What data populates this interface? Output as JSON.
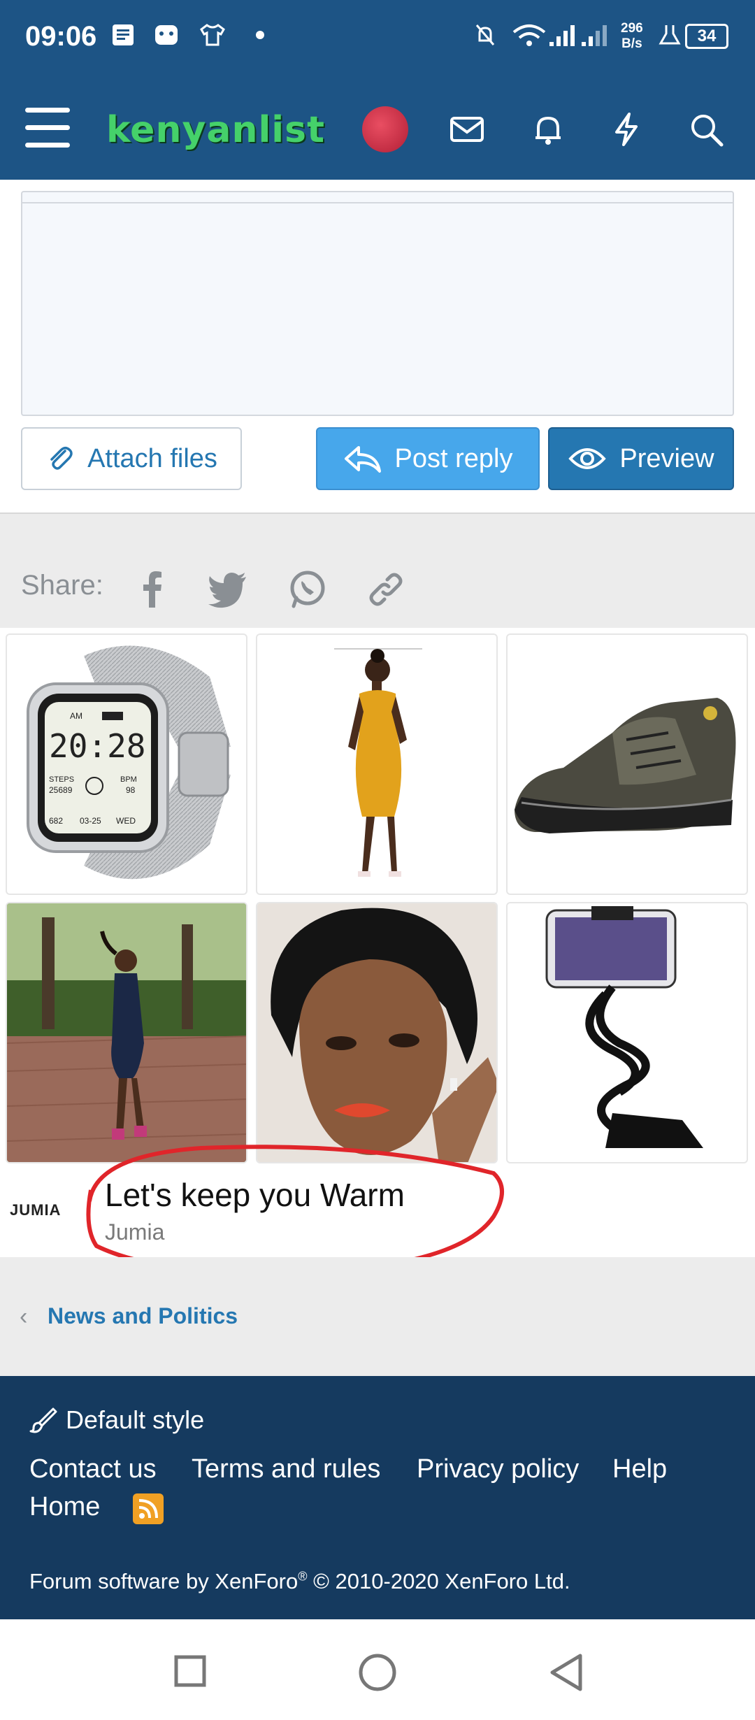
{
  "status_bar": {
    "time": "09:06",
    "network_speed_value": "296",
    "network_speed_unit": "B/s",
    "battery": "34",
    "icons": [
      "notes-icon",
      "game-icon",
      "shirt-icon",
      "dot-icon",
      "bell-off-icon",
      "wifi-icon",
      "signal-icon",
      "signal-icon-2",
      "lab-icon",
      "battery-icon"
    ]
  },
  "app_bar": {
    "logo": "kenyanlist",
    "icons": [
      "menu-icon",
      "avatar",
      "mail-icon",
      "bell-icon",
      "bolt-icon",
      "search-icon"
    ]
  },
  "editor": {
    "attach_label": "Attach files",
    "post_reply_label": "Post reply",
    "preview_label": "Preview"
  },
  "share": {
    "label": "Share:",
    "icons": [
      "facebook-icon",
      "twitter-icon",
      "whatsapp-icon",
      "link-icon"
    ]
  },
  "ad": {
    "brand": "JUMIA",
    "title": "Let's keep you Warm",
    "source": "Jumia",
    "watch_time": "20:28",
    "watch_steps": "25689",
    "watch_bpm": "98",
    "watch_date": "03-25",
    "watch_day": "WED",
    "watch_label_am": "AM",
    "watch_label_steps": "STEPS",
    "watch_label_bpm": "BPM",
    "watch_kcal": "682",
    "accent_color": "#1aa3b5",
    "annotation_color": "#e0252a"
  },
  "breadcrumb": {
    "link": "News and Politics"
  },
  "footer": {
    "style_label": "Default style",
    "links": [
      "Contact us",
      "Terms and rules",
      "Privacy policy",
      "Help",
      "Home"
    ],
    "copyright_prefix": "Forum software by XenForo",
    "copyright_mark": "®",
    "copyright_suffix": " © 2010-2020 XenForo Ltd."
  },
  "colors": {
    "header": "#1d5485",
    "footer": "#153a5f",
    "link": "#2577b1",
    "post_button": "#47a7eb"
  }
}
